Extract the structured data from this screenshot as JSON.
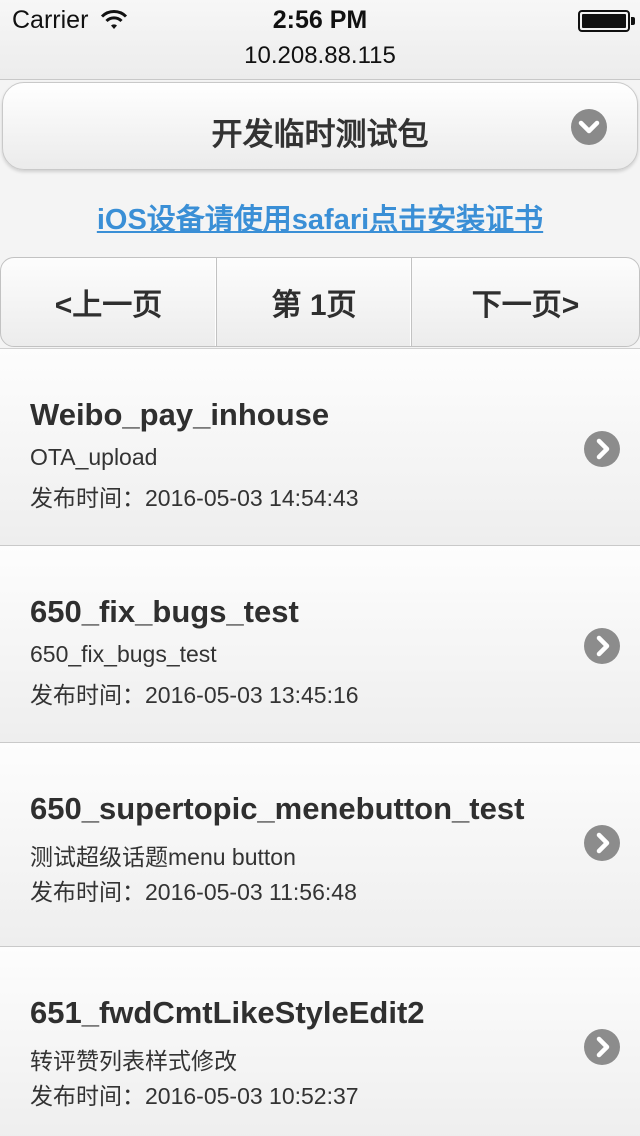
{
  "status": {
    "carrier": "Carrier",
    "time": "2:56 PM",
    "url": "10.208.88.115"
  },
  "header": {
    "title": "开发临时测试包"
  },
  "cert_link": "iOS设备请使用safari点击安装证书",
  "pager": {
    "prev": "<上一页",
    "current": "第 1页",
    "next": "下一页>"
  },
  "items": [
    {
      "name": "Weibo_pay_inhouse",
      "desc": "OTA_upload",
      "date": "发布时间：2016-05-03 14:54:43"
    },
    {
      "name": "650_fix_bugs_test",
      "desc": "650_fix_bugs_test",
      "date": "发布时间：2016-05-03 13:45:16"
    },
    {
      "name": "650_supertopic_menebutton_test",
      "desc": "测试超级话题menu button",
      "date": "发布时间：2016-05-03 11:56:48"
    },
    {
      "name": "651_fwdCmtLikeStyleEdit2",
      "desc": "转评赞列表样式修改",
      "date": "发布时间：2016-05-03 10:52:37"
    }
  ],
  "colors": {
    "link": "#3a8fd6",
    "icon": "#8c8c8c"
  },
  "icons": {
    "wifi": "wifi-icon",
    "battery": "battery-icon",
    "select": "chevron-down-icon",
    "row": "chevron-right-icon"
  }
}
